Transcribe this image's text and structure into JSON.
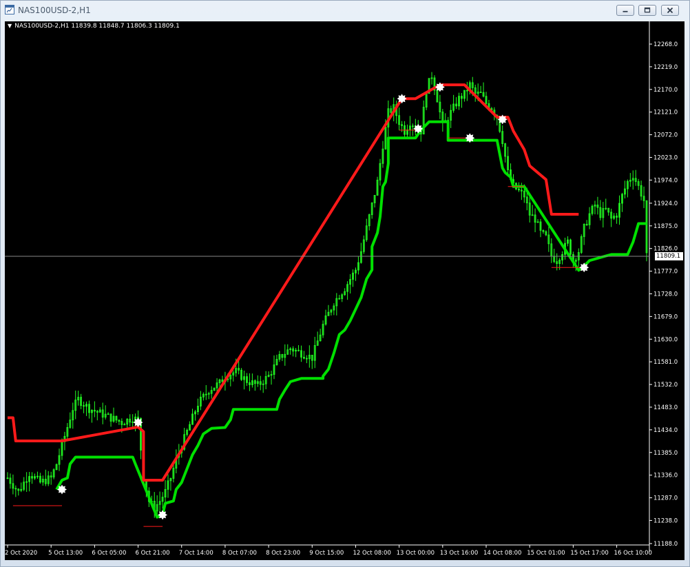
{
  "window": {
    "title": "NAS100USD-2,H1",
    "icon_name": "chart-window-icon",
    "buttons": [
      "minimize-icon",
      "restore-icon",
      "close-icon"
    ]
  },
  "chart_header": {
    "text": "NAS100USD-2,H1  11839.8 11848.7 11806.3 11809.1"
  },
  "current_price": {
    "value": 11809.1,
    "label": "11809.1"
  },
  "colors": {
    "background": "#000000",
    "candles": "#22ff22",
    "support_line": "#00e000",
    "resistance_line": "#ff1a1a",
    "markers": "#ffffff",
    "axis_text": "#ffffff",
    "bid_line": "#8a8a8a"
  },
  "chart_data": {
    "type": "line",
    "title": "NAS100USD-2,H1",
    "ylim": [
      11188.0,
      12293.0
    ],
    "price_ticks": [
      "12268.0",
      "12219.0",
      "12170.0",
      "12121.0",
      "12072.0",
      "12023.0",
      "11974.0",
      "11924.0",
      "11875.0",
      "11826.0",
      "11777.0",
      "11728.0",
      "11679.0",
      "11630.0",
      "11581.0",
      "11532.0",
      "11483.0",
      "11434.0",
      "11385.0",
      "11336.0",
      "11287.0",
      "11238.0",
      "11188.0"
    ],
    "price_tick_values": [
      12268,
      12219,
      12170,
      12121,
      12072,
      12023,
      11974,
      11924,
      11875,
      11826,
      11777,
      11728,
      11679,
      11630,
      11581,
      11532,
      11483,
      11434,
      11385,
      11336,
      11287,
      11238,
      11188
    ],
    "time_labels": [
      "2 Oct 2020",
      "5 Oct 13:00",
      "6 Oct 05:00",
      "6 Oct 21:00",
      "7 Oct 14:00",
      "8 Oct 07:00",
      "8 Oct 23:00",
      "9 Oct 15:00",
      "12 Oct 08:00",
      "13 Oct 00:00",
      "13 Oct 16:00",
      "14 Oct 08:00",
      "15 Oct 01:00",
      "15 Oct 17:00",
      "16 Oct 10:00"
    ],
    "x_count": 236,
    "time_label_indices": [
      0,
      16,
      32,
      48,
      64,
      80,
      96,
      112,
      128,
      144,
      160,
      176,
      192,
      208,
      224
    ],
    "close_series": [
      [
        0,
        11330
      ],
      [
        4,
        11300
      ],
      [
        8,
        11340
      ],
      [
        12,
        11320
      ],
      [
        16,
        11330
      ],
      [
        18,
        11360
      ],
      [
        20,
        11400
      ],
      [
        24,
        11480
      ],
      [
        26,
        11500
      ],
      [
        30,
        11480
      ],
      [
        34,
        11470
      ],
      [
        38,
        11460
      ],
      [
        42,
        11450
      ],
      [
        46,
        11460
      ],
      [
        48,
        11455
      ],
      [
        50,
        11330
      ],
      [
        52,
        11280
      ],
      [
        54,
        11265
      ],
      [
        56,
        11280
      ],
      [
        58,
        11300
      ],
      [
        60,
        11330
      ],
      [
        62,
        11370
      ],
      [
        64,
        11400
      ],
      [
        66,
        11430
      ],
      [
        70,
        11490
      ],
      [
        74,
        11520
      ],
      [
        78,
        11535
      ],
      [
        80,
        11550
      ],
      [
        84,
        11560
      ],
      [
        88,
        11540
      ],
      [
        92,
        11530
      ],
      [
        96,
        11550
      ],
      [
        100,
        11590
      ],
      [
        104,
        11610
      ],
      [
        108,
        11600
      ],
      [
        112,
        11590
      ],
      [
        116,
        11660
      ],
      [
        120,
        11710
      ],
      [
        124,
        11740
      ],
      [
        128,
        11780
      ],
      [
        130,
        11820
      ],
      [
        132,
        11870
      ],
      [
        134,
        11920
      ],
      [
        136,
        11970
      ],
      [
        138,
        12050
      ],
      [
        140,
        12120
      ],
      [
        142,
        12130
      ],
      [
        144,
        12100
      ],
      [
        146,
        12080
      ],
      [
        148,
        12100
      ],
      [
        150,
        12090
      ],
      [
        152,
        12080
      ],
      [
        154,
        12170
      ],
      [
        156,
        12200
      ],
      [
        158,
        12150
      ],
      [
        160,
        12090
      ],
      [
        162,
        12110
      ],
      [
        164,
        12130
      ],
      [
        166,
        12150
      ],
      [
        168,
        12160
      ],
      [
        170,
        12180
      ],
      [
        172,
        12160
      ],
      [
        174,
        12160
      ],
      [
        176,
        12140
      ],
      [
        178,
        12130
      ],
      [
        180,
        12110
      ],
      [
        182,
        12060
      ],
      [
        184,
        11990
      ],
      [
        186,
        11960
      ],
      [
        188,
        11950
      ],
      [
        190,
        11940
      ],
      [
        192,
        11900
      ],
      [
        194,
        11890
      ],
      [
        196,
        11860
      ],
      [
        198,
        11850
      ],
      [
        200,
        11810
      ],
      [
        202,
        11800
      ],
      [
        204,
        11820
      ],
      [
        206,
        11840
      ],
      [
        208,
        11800
      ],
      [
        210,
        11820
      ],
      [
        212,
        11870
      ],
      [
        214,
        11900
      ],
      [
        216,
        11920
      ],
      [
        218,
        11900
      ],
      [
        220,
        11910
      ],
      [
        222,
        11890
      ],
      [
        224,
        11900
      ],
      [
        226,
        11940
      ],
      [
        228,
        11970
      ],
      [
        230,
        11985
      ],
      [
        232,
        11960
      ],
      [
        234,
        11930
      ],
      [
        235,
        11809
      ]
    ],
    "series": [
      {
        "points": [
          [
            18,
            11305
          ],
          [
            20,
            11325
          ],
          [
            22,
            11330
          ],
          [
            23,
            11360
          ],
          [
            25,
            11375
          ],
          [
            46,
            11375
          ],
          [
            47,
            11360
          ],
          [
            55,
            11245
          ],
          [
            57,
            11250
          ],
          [
            58,
            11275
          ],
          [
            61,
            11280
          ],
          [
            62,
            11305
          ],
          [
            64,
            11320
          ],
          [
            66,
            11350
          ],
          [
            68,
            11380
          ],
          [
            70,
            11400
          ],
          [
            72,
            11425
          ],
          [
            75,
            11437
          ],
          [
            80,
            11439
          ],
          [
            82,
            11456
          ],
          [
            83,
            11478
          ],
          [
            99,
            11478
          ],
          [
            100,
            11500
          ],
          [
            102,
            11520
          ],
          [
            104,
            11538
          ],
          [
            108,
            11545
          ],
          [
            116,
            11545
          ],
          [
            116,
            11550
          ],
          [
            118,
            11565
          ],
          [
            120,
            11600
          ],
          [
            122,
            11640
          ],
          [
            124,
            11650
          ],
          [
            126,
            11670
          ],
          [
            128,
            11695
          ],
          [
            130,
            11720
          ],
          [
            132,
            11760
          ],
          [
            134,
            11780
          ],
          [
            134,
            11830
          ],
          [
            136,
            11860
          ],
          [
            137,
            11895
          ],
          [
            138,
            11960
          ],
          [
            139,
            11970
          ],
          [
            140,
            12010
          ],
          [
            140,
            12065
          ],
          [
            150,
            12065
          ],
          [
            152,
            12082
          ],
          [
            155,
            12100
          ],
          [
            162,
            12100
          ],
          [
            162,
            12060
          ],
          [
            180,
            12060
          ],
          [
            182,
            12000
          ],
          [
            183,
            11990
          ],
          [
            185,
            11980
          ],
          [
            186,
            11960
          ],
          [
            188,
            11960
          ],
          [
            190,
            11960
          ],
          [
            210,
            11779
          ],
          [
            212,
            11788
          ],
          [
            214,
            11800
          ],
          [
            220,
            11810
          ],
          [
            222,
            11813
          ],
          [
            228,
            11813
          ],
          [
            230,
            11840
          ],
          [
            232,
            11880
          ],
          [
            235,
            11880
          ]
        ]
      },
      {
        "points": [
          [
            0,
            11460
          ],
          [
            2,
            11460
          ],
          [
            3,
            11410
          ],
          [
            20,
            11410
          ],
          [
            48,
            11440
          ],
          [
            50,
            11430
          ],
          [
            50,
            11325
          ],
          [
            57,
            11325
          ],
          [
            145,
            12150
          ],
          [
            150,
            12150
          ],
          [
            159,
            12180
          ],
          [
            168,
            12180
          ],
          [
            180,
            12110
          ],
          [
            184,
            12110
          ],
          [
            186,
            12080
          ],
          [
            188,
            12060
          ],
          [
            190,
            12040
          ],
          [
            192,
            12005
          ],
          [
            194,
            11995
          ],
          [
            196,
            11985
          ],
          [
            198,
            11975
          ],
          [
            200,
            11900
          ],
          [
            210,
            11900
          ]
        ]
      }
    ],
    "markers": [
      [
        20,
        11305
      ],
      [
        48,
        11450
      ],
      [
        57,
        11250
      ],
      [
        145,
        12150
      ],
      [
        151,
        12085
      ],
      [
        159,
        12175
      ],
      [
        170,
        12065
      ],
      [
        182,
        12105
      ],
      [
        212,
        11785
      ]
    ],
    "grid": false
  }
}
